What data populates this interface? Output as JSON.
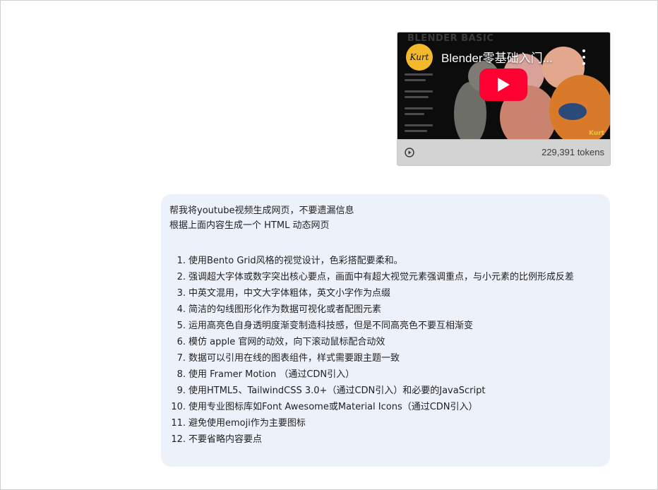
{
  "video": {
    "title": "Blender零基础入门...",
    "channel_logo_text": "Kurt",
    "thumbnail_watermark": "BLENDER BASIC",
    "thumbnail_corner_text": "Kurt",
    "tokens": "229,391 tokens",
    "colors": {
      "play_button": "#ff0033",
      "logo_bg": "#f4b92a"
    }
  },
  "message": {
    "line1": "帮我将youtube视频生成网页，不要遗漏信息",
    "line2": "根据上面内容生成一个 HTML 动态网页",
    "requirements": [
      "使用Bento Grid风格的视觉设计，色彩搭配要柔和。",
      "强调超大字体或数字突出核心要点，画面中有超大视觉元素强调重点，与小元素的比例形成反差",
      "中英文混用，中文大字体粗体，英文小字作为点缀",
      "简洁的勾线图形化作为数据可视化或者配图元素",
      "运用高亮色自身透明度渐变制造科技感，但是不同高亮色不要互相渐变",
      "模仿 apple 官网的动效，向下滚动鼠标配合动效",
      "数据可以引用在线的图表组件，样式需要跟主题一致",
      "使用 Framer Motion （通过CDN引入）",
      "使用HTML5、TailwindCSS 3.0+（通过CDN引入）和必要的JavaScript",
      "使用专业图标库如Font Awesome或Material Icons（通过CDN引入）",
      "避免使用emoji作为主要图标",
      "不要省略内容要点"
    ],
    "colors": {
      "bubble_bg": "#edf2fa"
    }
  }
}
